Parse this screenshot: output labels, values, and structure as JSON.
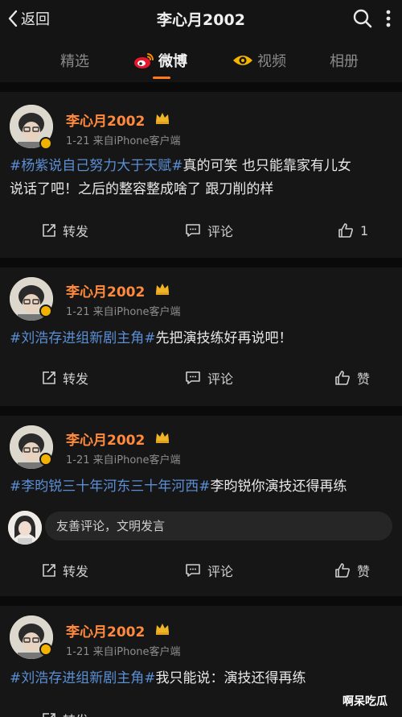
{
  "header": {
    "back_label": "返回",
    "title": "李心月2002",
    "back_icon": "chevron-left-icon",
    "search_icon": "search-icon",
    "more_icon": "more-vertical-icon"
  },
  "tabs": [
    {
      "label": "精选",
      "active": false
    },
    {
      "label": "微博",
      "active": true,
      "icon": "weibo-icon"
    },
    {
      "label": "视频",
      "active": false,
      "icon": "video-eye-icon"
    },
    {
      "label": "相册",
      "active": false
    }
  ],
  "posts": [
    {
      "username": "李心月2002",
      "meta": "1-21 来自iPhone客户端",
      "content_line1_tag": "#杨紫说自己努力大于天赋#",
      "content_line1_rest": "真的可笑 也只能靠家有儿女",
      "content_line2": "说话了吧！之后的整容整成啥了 跟刀削的样",
      "repost_label": "转发",
      "comment_label": "评论",
      "like_label": "1"
    },
    {
      "username": "李心月2002",
      "meta": "1-21 来自iPhone客户端",
      "content_tag": "#刘浩存进组新剧主角#",
      "content_rest": "先把演技练好再说吧！",
      "repost_label": "转发",
      "comment_label": "评论",
      "like_label": "赞"
    },
    {
      "username": "李心月2002",
      "meta": "1-21 来自iPhone客户端",
      "content_tag": "#李昀锐三十年河东三十年河西#",
      "content_rest": "李昀锐你演技还得再练",
      "comment_placeholder": "友善评论，文明发言",
      "repost_label": "转发",
      "comment_label": "评论",
      "like_label": "赞"
    },
    {
      "username": "李心月2002",
      "meta": "1-21 来自iPhone客户端",
      "content_tag": "#刘浩存进组新剧主角#",
      "content_rest": "我只能说：演技还得再练",
      "repost_label": "转发"
    }
  ],
  "watermark": "啊呆吃瓜",
  "colors": {
    "accent": "#ff7a1a",
    "username": "#ff8a3d",
    "hashtag": "#5b8fd6",
    "background": "#0f0f0f",
    "card": "#161616"
  }
}
